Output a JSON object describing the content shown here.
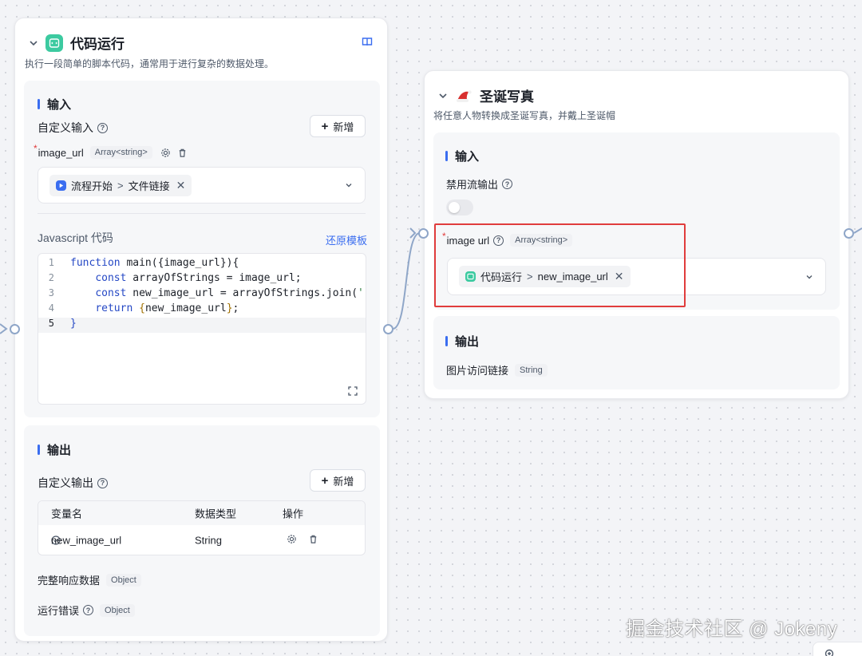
{
  "code_node": {
    "title": "代码运行",
    "description": "执行一段简单的脚本代码，通常用于进行复杂的数据处理。",
    "input_section": "输入",
    "custom_input_label": "自定义输入",
    "add_label": "新增",
    "param": {
      "name": "image_url",
      "type": "Array<string>"
    },
    "ref": {
      "source": "流程开始",
      "field": "文件链接"
    },
    "code_label": "Javascript 代码",
    "restore_label": "还原模板",
    "code_lines": [
      {
        "n": "1",
        "text": "function main({image_url}){"
      },
      {
        "n": "2",
        "text": "    const arrayOfStrings = image_url;"
      },
      {
        "n": "3",
        "text": "    const new_image_url = arrayOfStrings.join(',"
      },
      {
        "n": "4",
        "text": "    return {new_image_url};"
      },
      {
        "n": "5",
        "text": "}"
      }
    ],
    "output_section": "输出",
    "custom_output_label": "自定义输出",
    "table_headers": {
      "name": "变量名",
      "type": "数据类型",
      "ops": "操作"
    },
    "output_row": {
      "name": "new_image_url",
      "type": "String"
    },
    "full_response": {
      "label": "完整响应数据",
      "type": "Object"
    },
    "run_error": {
      "label": "运行错误",
      "type": "Object"
    }
  },
  "xmas_node": {
    "title": "圣诞写真",
    "description": "将任意人物转换成圣诞写真，并戴上圣诞帽",
    "input_section": "输入",
    "disable_stream_label": "禁用流输出",
    "param": {
      "name": "image url",
      "type": "Array<string>"
    },
    "ref": {
      "source": "代码运行",
      "field": "new_image_url"
    },
    "output_section": "输出",
    "output_field": {
      "name": "图片访问链接",
      "type": "String"
    }
  },
  "watermark": "掘金技术社区 @ Jokeny",
  "colors": {
    "accent": "#3a6df0",
    "highlight": "#e03c3c",
    "code_icon": "#3ccaa0"
  }
}
